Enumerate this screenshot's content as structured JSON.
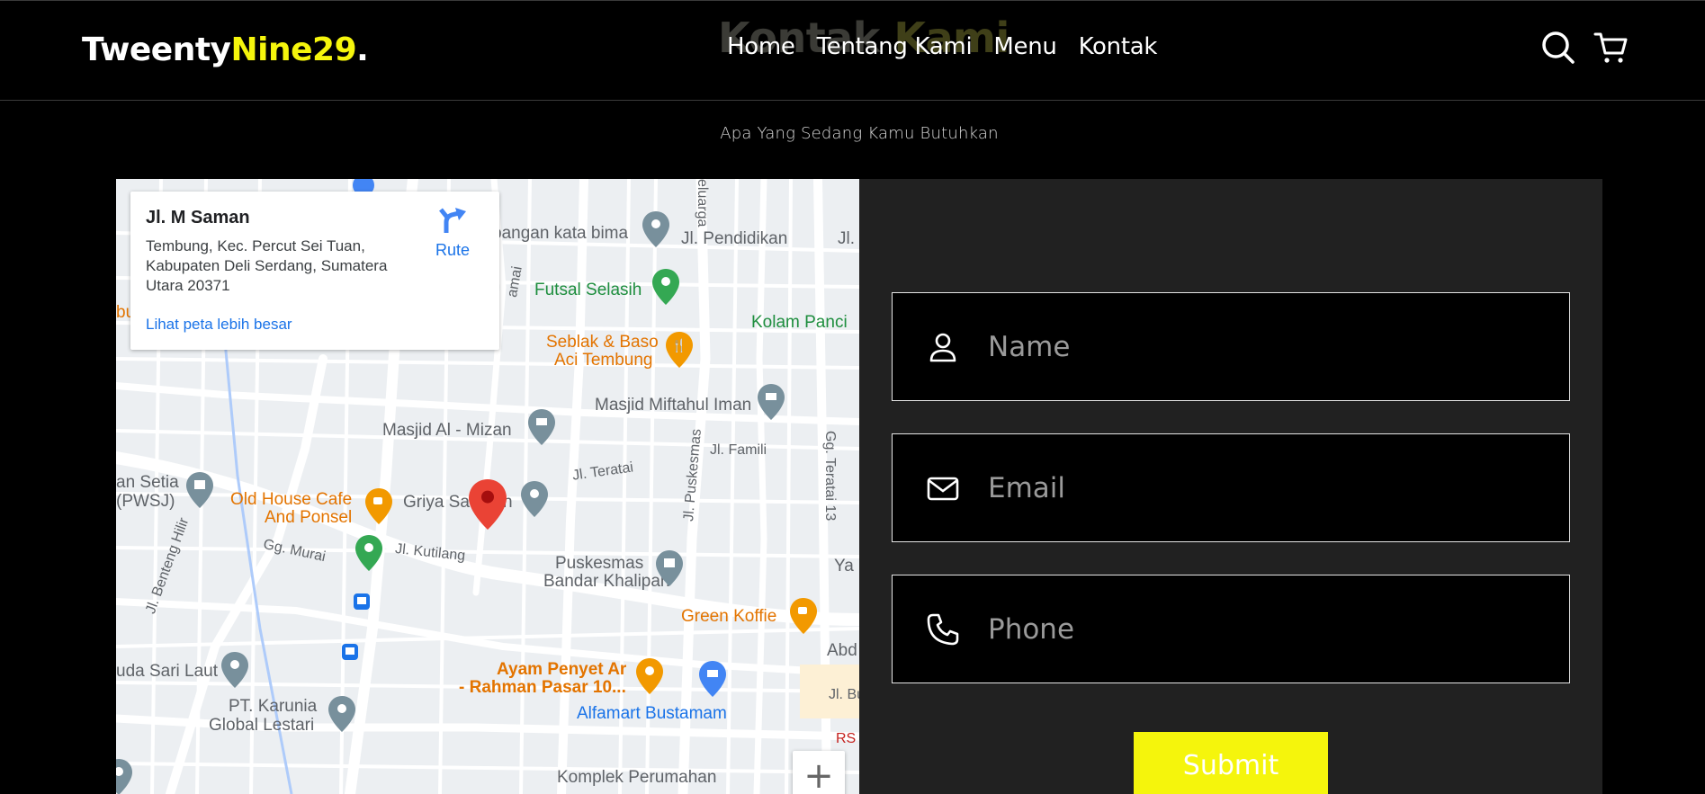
{
  "header": {
    "logo_part1": "Tweenty",
    "logo_part2": "Nine29",
    "logo_part3": ".",
    "ghost_title_part1": "Kontak",
    "ghost_title_part2": "Kami",
    "nav": [
      "Home",
      "Tentang Kami",
      "Menu",
      "Kontak"
    ],
    "icons": [
      "search-icon",
      "cart-icon"
    ]
  },
  "subtitle": "Apa Yang Sedang Kamu Butuhkan",
  "map": {
    "card": {
      "street": "Jl. M Saman",
      "address": "Tembung, Kec. Percut Sei Tuan, Kabupaten Deli Serdang, Sumatera Utara 20371",
      "route_label": "Rute",
      "bigger_map_link": "Lihat peta lebih besar"
    },
    "labels": {
      "futsal": "Futsal Selasih",
      "kolam": "Kolam Panci",
      "seblak1": "Seblak & Baso",
      "seblak2": "Aci Tembung",
      "miftahul": "Masjid Miftahul Iman",
      "mizan": "Masjid Al - Mizan",
      "famili": "Jl. Famili",
      "teratai": "Jl. Teratai",
      "pendidikan": "Jl. Pendidikan",
      "bangan": "bangan kata bima",
      "setia1": "an Setia",
      "setia2": "(PWSJ)",
      "oldhouse1": "Old House Cafe",
      "oldhouse2": "And Ponsel",
      "griya": "Griya Sa",
      "griya_tail": "h",
      "murai": "Gg. Murai",
      "kutilang": "Jl. Kutilang",
      "puskesmas1": "Puskesmas",
      "puskesmas2": "Bandar Khalipah",
      "greenkoffie": "Green Koffie",
      "sarilaut": "uda Sari Laut",
      "ayam1": "Ayam Penyet Ar",
      "ayam2": "- Rahman Pasar 10...",
      "alfamart": "Alfamart Bustamam",
      "karunia1": "PT. Karunia",
      "karunia2": "Global Lestari",
      "komplek": "Komplek Perumahan",
      "benteng": "Jl. Benteng Hilir",
      "jlpuskesmas": "Jl. Puskesmas",
      "ggteratai": "Gg. Teratai 13",
      "abd": "Abd",
      "jlbust": "Jl. Bust",
      "ya": "Ya",
      "jl": "Jl.",
      "rs": "RS",
      "bu": "bu",
      "amai": "amai",
      "elugra": "eluarga"
    },
    "zoom_label": "+"
  },
  "form": {
    "name_placeholder": "Name",
    "email_placeholder": "Email",
    "phone_placeholder": "Phone",
    "submit_label": "Submit"
  },
  "colors": {
    "accent": "#f5f50c",
    "panel": "#212121",
    "background": "#000000"
  }
}
